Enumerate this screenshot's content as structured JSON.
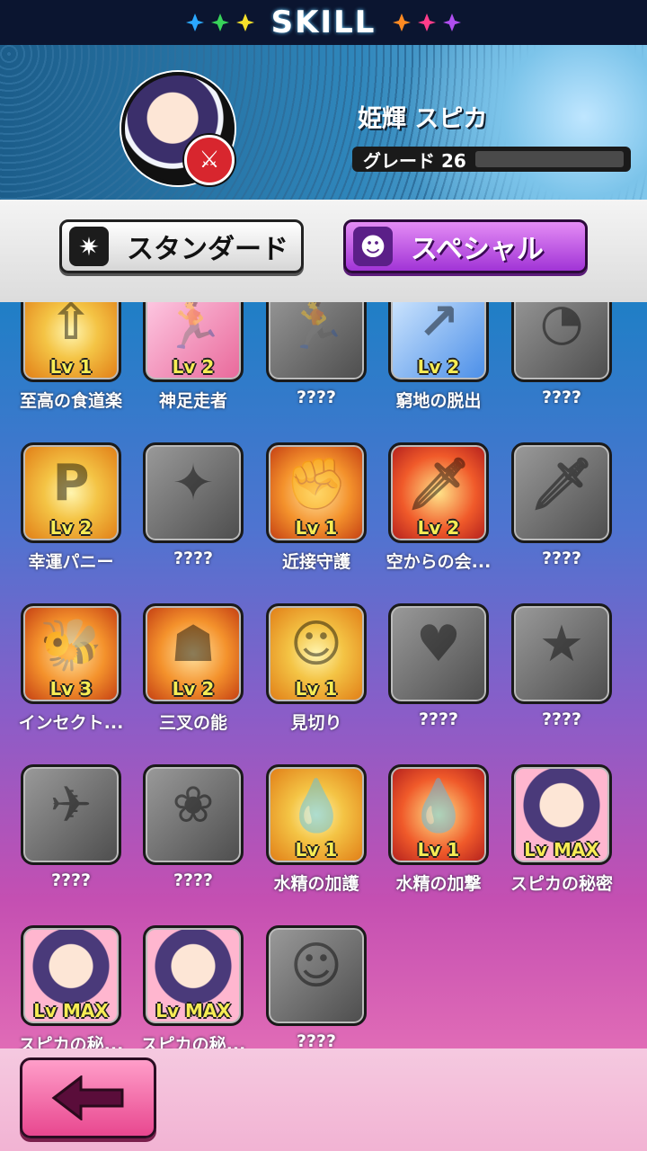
{
  "header_title": "SKILL",
  "character": {
    "name": "姫輝 スピカ",
    "grade_label": "グレード 26"
  },
  "tabs": [
    {
      "label": "スタンダード",
      "icon": "standard-icon"
    },
    {
      "label": "スペシャル",
      "icon": "special-icon"
    }
  ],
  "skills": [
    {
      "name": "至高の食道楽",
      "level": "Lv 1",
      "color": "c-gold",
      "glyph": "⇧"
    },
    {
      "name": "神足走者",
      "level": "Lv 2",
      "color": "c-pink",
      "glyph": "🏃"
    },
    {
      "name": "????",
      "level": "",
      "color": "c-gray",
      "glyph": "🏃"
    },
    {
      "name": "窮地の脱出",
      "level": "Lv 2",
      "color": "c-blue",
      "glyph": "↗"
    },
    {
      "name": "????",
      "level": "",
      "color": "c-gray",
      "glyph": "◔"
    },
    {
      "name": "幸運パニー",
      "level": "Lv 2",
      "color": "c-gold",
      "glyph": "P"
    },
    {
      "name": "????",
      "level": "",
      "color": "c-gray",
      "glyph": "✦"
    },
    {
      "name": "近接守護",
      "level": "Lv 1",
      "color": "c-orange",
      "glyph": "✊"
    },
    {
      "name": "空からの会...",
      "level": "Lv 2",
      "color": "c-red",
      "glyph": "🗡"
    },
    {
      "name": "????",
      "level": "",
      "color": "c-gray",
      "glyph": "🗡"
    },
    {
      "name": "インセクト...",
      "level": "Lv 3",
      "color": "c-orange",
      "glyph": "🐝"
    },
    {
      "name": "三叉の能",
      "level": "Lv 2",
      "color": "c-orange",
      "glyph": "☗"
    },
    {
      "name": "見切り",
      "level": "Lv 1",
      "color": "c-gold",
      "glyph": "☺"
    },
    {
      "name": "????",
      "level": "",
      "color": "c-gray",
      "glyph": "♥"
    },
    {
      "name": "????",
      "level": "",
      "color": "c-gray",
      "glyph": "★"
    },
    {
      "name": "????",
      "level": "",
      "color": "c-gray",
      "glyph": "✈"
    },
    {
      "name": "????",
      "level": "",
      "color": "c-gray",
      "glyph": "❀"
    },
    {
      "name": "水精の加護",
      "level": "Lv 1",
      "color": "c-gold",
      "glyph": "💧"
    },
    {
      "name": "水精の加撃",
      "level": "Lv 1",
      "color": "c-red",
      "glyph": "💧"
    },
    {
      "name": "スピカの秘密",
      "level": "Lv MAX",
      "color": "c-char",
      "glyph": ""
    },
    {
      "name": "スピカの秘...",
      "level": "Lv MAX",
      "color": "c-char",
      "glyph": ""
    },
    {
      "name": "スピカの秘...",
      "level": "Lv MAX",
      "color": "c-char",
      "glyph": ""
    },
    {
      "name": "????",
      "level": "",
      "color": "c-gray",
      "glyph": "☺"
    }
  ],
  "back_button_icon": "back-arrow-icon"
}
